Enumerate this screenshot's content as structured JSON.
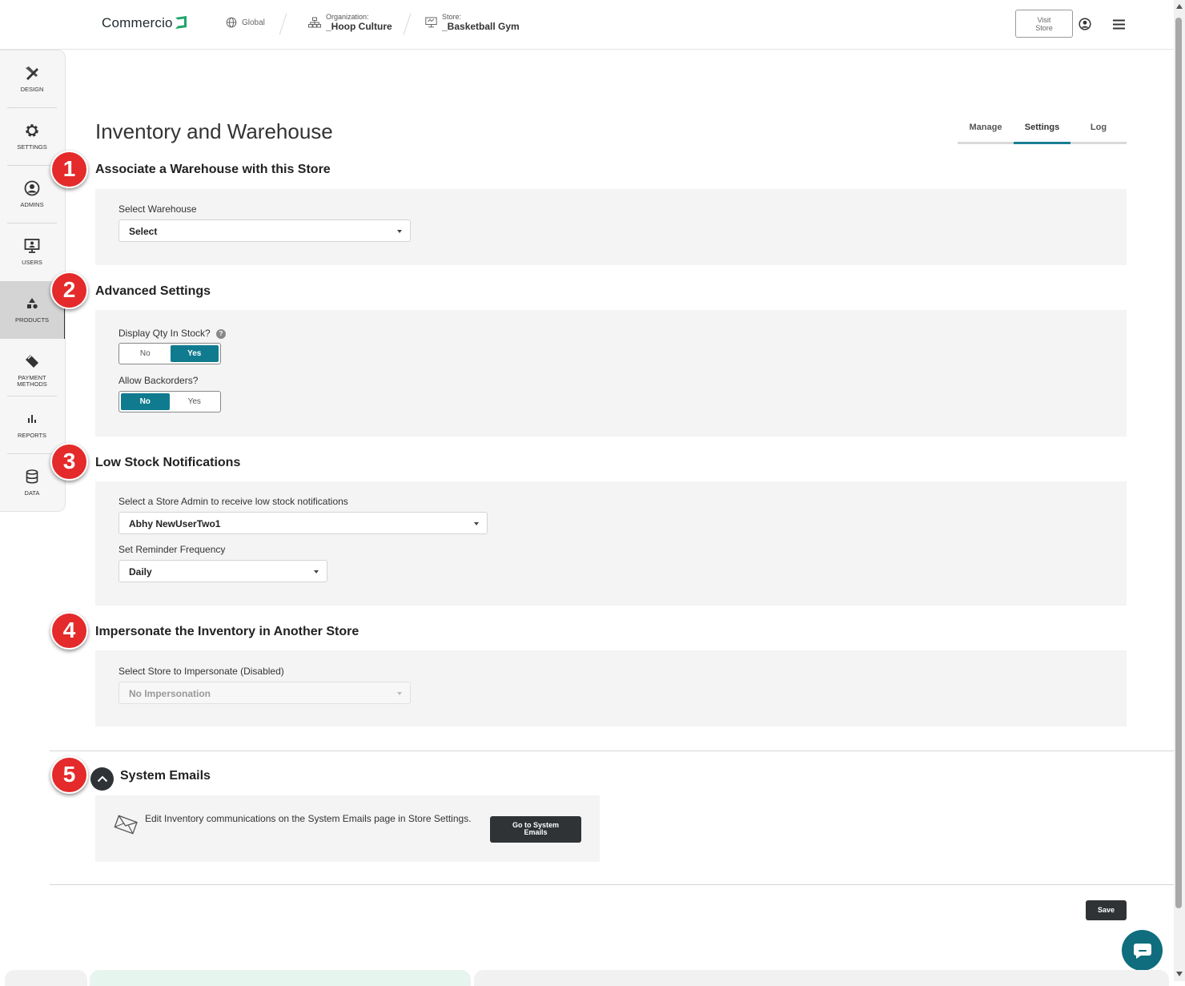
{
  "header": {
    "logo": "Commercio",
    "global_label": "Global",
    "organization_caption": "Organization:",
    "organization_name": "_Hoop Culture",
    "store_caption": "Store:",
    "store_name": "_Basketball Gym",
    "visit_store_line1": "Visit",
    "visit_store_line2": "Store"
  },
  "sidebar": {
    "items": [
      {
        "label": "Design",
        "icon": "design-tools-icon"
      },
      {
        "label": "Settings",
        "icon": "gear-icon"
      },
      {
        "label": "Admins",
        "icon": "admin-user-icon"
      },
      {
        "label": "Users",
        "icon": "monitor-user-icon"
      },
      {
        "label": "Products",
        "icon": "shapes-icon",
        "active": true
      },
      {
        "label": "Payment",
        "label2": "Methods",
        "icon": "card-icon"
      },
      {
        "label": "Reports",
        "icon": "bar-chart-icon"
      },
      {
        "label": "Data",
        "icon": "database-icon"
      }
    ]
  },
  "page": {
    "title": "Inventory and Warehouse",
    "tabs": [
      "Manage",
      "Settings",
      "Log"
    ],
    "active_tab": "Settings"
  },
  "sections": {
    "warehouse": {
      "badge": "1",
      "title": "Associate a Warehouse with this Store",
      "label": "Select Warehouse",
      "value": "Select"
    },
    "advanced": {
      "badge": "2",
      "title": "Advanced Settings",
      "display_qty_label": "Display Qty In Stock?",
      "help": "?",
      "display_qty_options": [
        "No",
        "Yes"
      ],
      "display_qty_selected": "Yes",
      "backorders_label": "Allow Backorders?",
      "backorders_options": [
        "No",
        "Yes"
      ],
      "backorders_selected": "No"
    },
    "low_stock": {
      "badge": "3",
      "title": "Low Stock Notifications",
      "admin_label": "Select a Store Admin to receive low stock notifications",
      "admin_value": "Abhy NewUserTwo1",
      "frequency_label": "Set Reminder Frequency",
      "frequency_value": "Daily"
    },
    "impersonate": {
      "badge": "4",
      "title": "Impersonate the Inventory in Another Store",
      "label": "Select Store to Impersonate (Disabled)",
      "value": "No Impersonation"
    },
    "system_emails": {
      "badge": "5",
      "title": "System Emails",
      "text": "Edit Inventory communications on the System Emails page in Store Settings.",
      "button_line1": "Go to System",
      "button_line2": "Emails"
    }
  },
  "footer": {
    "save_label": "Save"
  },
  "colors": {
    "accent": "#107b8f",
    "badge_red": "#e42a2a",
    "dark_button": "#2f3336",
    "panel_bg": "#f4f4f4"
  }
}
